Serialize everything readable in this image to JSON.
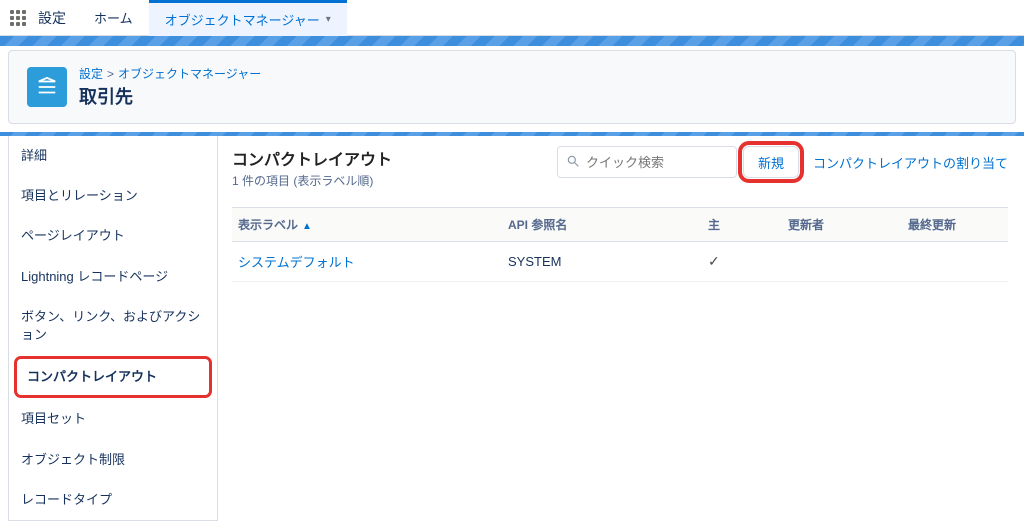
{
  "topbar": {
    "title": "設定",
    "tabs": [
      {
        "label": "ホーム",
        "active": false
      },
      {
        "label": "オブジェクトマネージャー",
        "active": true
      }
    ]
  },
  "breadcrumb": {
    "root": "設定",
    "parent": "オブジェクトマネージャー"
  },
  "page_title": "取引先",
  "sidebar": {
    "items": [
      {
        "label": "詳細",
        "active": false
      },
      {
        "label": "項目とリレーション",
        "active": false
      },
      {
        "label": "ページレイアウト",
        "active": false
      },
      {
        "label": "Lightning レコードページ",
        "active": false
      },
      {
        "label": "ボタン、リンク、およびアクション",
        "active": false
      },
      {
        "label": "コンパクトレイアウト",
        "active": true
      },
      {
        "label": "項目セット",
        "active": false
      },
      {
        "label": "オブジェクト制限",
        "active": false
      },
      {
        "label": "レコードタイプ",
        "active": false
      }
    ]
  },
  "content": {
    "title": "コンパクトレイアウト",
    "subtitle": "1 件の項目 (表示ラベル順)",
    "search_placeholder": "クイック検索",
    "new_button": "新規",
    "assign_link": "コンパクトレイアウトの割り当て",
    "columns": {
      "label": "表示ラベル",
      "api": "API 参照名",
      "primary": "主",
      "modified_by": "更新者",
      "last_modified": "最終更新"
    },
    "rows": [
      {
        "label": "システムデフォルト",
        "api": "SYSTEM",
        "primary": true,
        "modified_by": "",
        "last_modified": ""
      }
    ]
  }
}
